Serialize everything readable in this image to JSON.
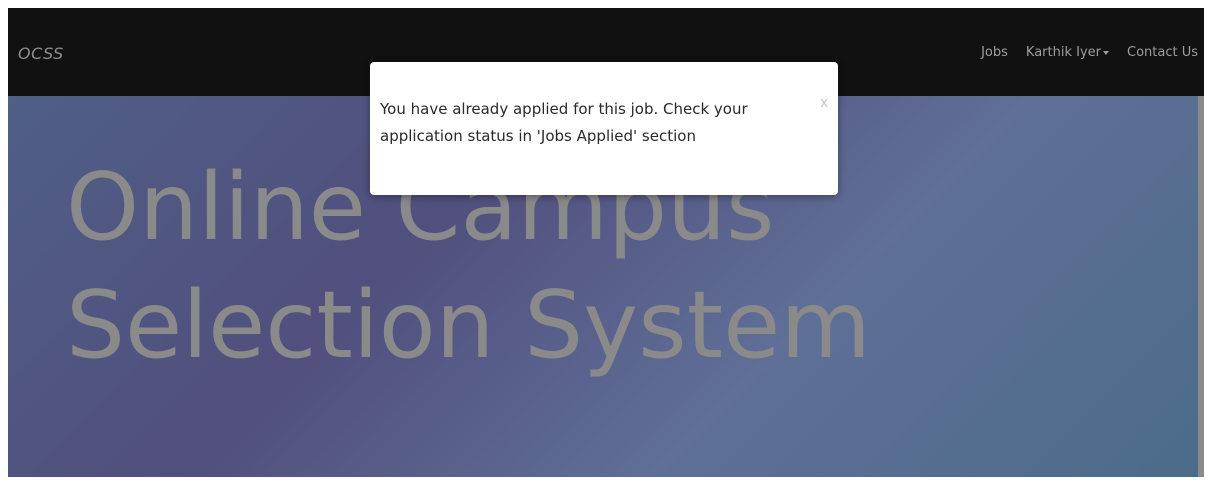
{
  "navbar": {
    "brand": "OCSS",
    "links": {
      "jobs": "Jobs",
      "user": "Karthik Iyer",
      "contact": "Contact Us"
    }
  },
  "hero": {
    "title": "Online Campus Selection System"
  },
  "alert": {
    "message": "You have already applied for this job. Check your application status in 'Jobs Applied' section",
    "close_label": "x"
  },
  "colors": {
    "navbar_bg": "#111111",
    "hero_gradient_start": "#4f5f86",
    "hero_gradient_end": "#4b6c89",
    "hero_title": "#8a8a8a",
    "alert_bg": "#ffffff"
  }
}
